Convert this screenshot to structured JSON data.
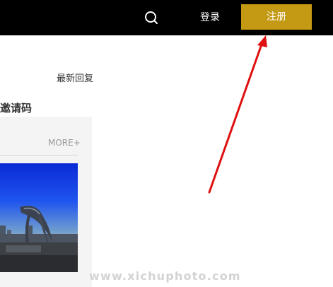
{
  "header": {
    "login_label": "登录",
    "register_label": "注册",
    "search_icon": "search-icon",
    "background_color": "#000000",
    "register_color": "#c49a14"
  },
  "main": {
    "latest_reply_label": "最新回复",
    "section_title": "邀请码",
    "more_label": "MORE+",
    "photo": "sculpture photo at dusk"
  },
  "watermark": "www.xichuphoto.com",
  "annotation": {
    "color": "#e01010",
    "type": "red arrow pointing to register button"
  }
}
